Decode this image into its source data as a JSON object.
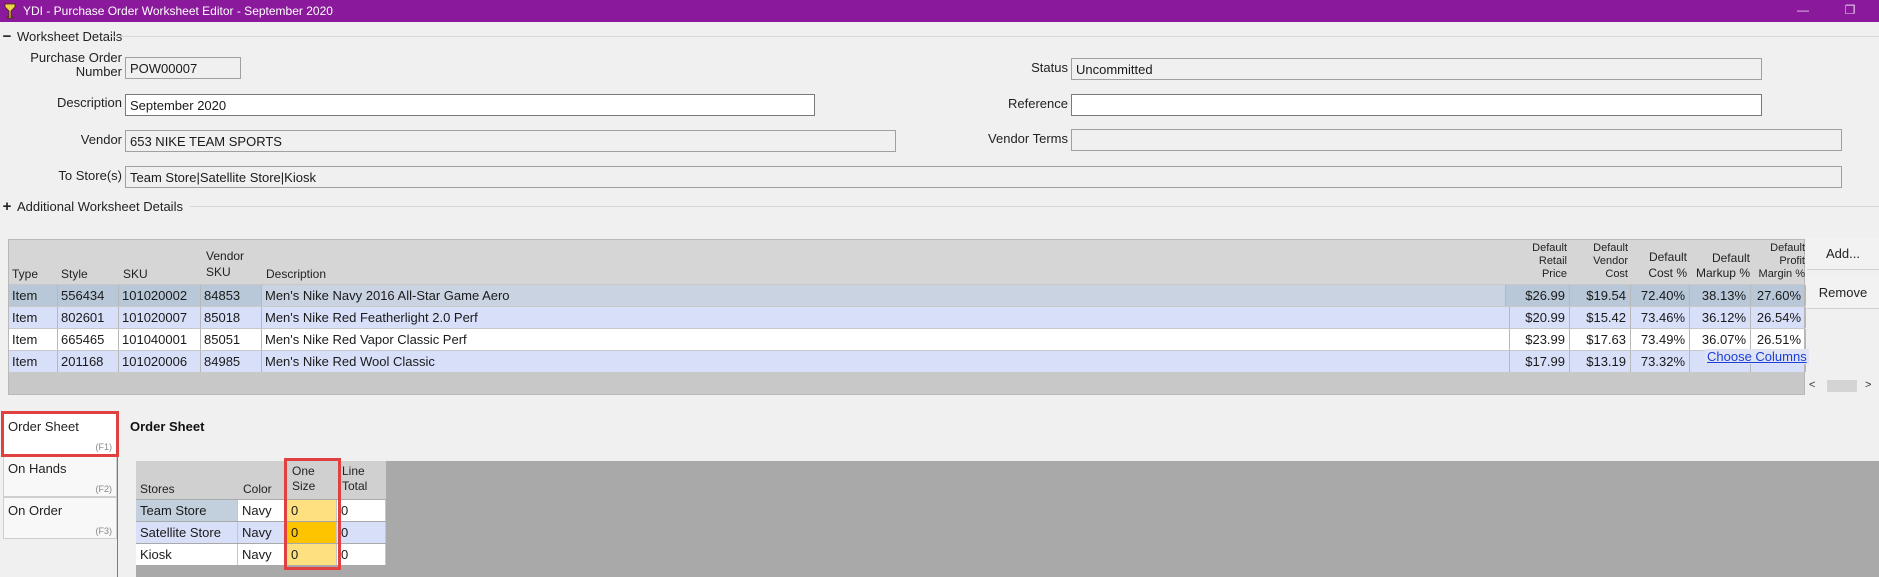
{
  "window": {
    "title": "YDI - Purchase Order Worksheet Editor - September 2020",
    "app_icon": "ydi-logo-icon",
    "title_color": "#8a1a9b"
  },
  "sections": {
    "worksheet_details": "Worksheet Details",
    "additional_details": "Additional Worksheet Details"
  },
  "form": {
    "po_number_label": "Purchase Order Number",
    "po_number": "POW00007",
    "description_label": "Description",
    "description": "September 2020",
    "vendor_label": "Vendor",
    "vendor": "653 NIKE TEAM SPORTS",
    "to_stores_label": "To Store(s)",
    "to_stores": "Team Store|Satellite Store|Kiosk",
    "status_label": "Status",
    "status": "Uncommitted",
    "reference_label": "Reference",
    "reference": "",
    "vendor_terms_label": "Vendor Terms",
    "vendor_terms": ""
  },
  "items_grid": {
    "headers": {
      "type": "Type",
      "style": "Style",
      "sku": "SKU",
      "vendor_sku_1": "Vendor",
      "vendor_sku_2": "SKU",
      "description": "Description",
      "retail_1": "Default",
      "retail_2": "Retail",
      "retail_3": "Price",
      "vcost_1": "Default",
      "vcost_2": "Vendor",
      "vcost_3": "Cost",
      "costpct_1": "Default",
      "costpct_2": "Cost %",
      "markup_1": "Default",
      "markup_2": "Markup %",
      "margin_1": "Default",
      "margin_2": "Profit",
      "margin_3": "Margin %"
    },
    "rows": [
      {
        "type": "Item",
        "style": "556434",
        "sku": "101020002",
        "vendor_sku": "84853",
        "description": "Men's Nike Navy 2016 All-Star Game Aero",
        "retail": "$26.99",
        "vendor_cost": "$19.54",
        "cost_pct": "72.40%",
        "markup_pct": "38.13%",
        "margin_pct": "27.60%"
      },
      {
        "type": "Item",
        "style": "802601",
        "sku": "101020007",
        "vendor_sku": "85018",
        "description": "Men's Nike Red Featherlight 2.0 Perf",
        "retail": "$20.99",
        "vendor_cost": "$15.42",
        "cost_pct": "73.46%",
        "markup_pct": "36.12%",
        "margin_pct": "26.54%"
      },
      {
        "type": "Item",
        "style": "665465",
        "sku": "101040001",
        "vendor_sku": "85051",
        "description": "Men's Nike Red Vapor Classic Perf",
        "retail": "$23.99",
        "vendor_cost": "$17.63",
        "cost_pct": "73.49%",
        "markup_pct": "36.07%",
        "margin_pct": "26.51%"
      },
      {
        "type": "Item",
        "style": "201168",
        "sku": "101020006",
        "vendor_sku": "84985",
        "description": "Men's Nike Red Wool Classic",
        "retail": "$17.99",
        "vendor_cost": "$13.19",
        "cost_pct": "73.32%",
        "markup_pct": "",
        "margin_pct": ""
      }
    ],
    "add_button": "Add...",
    "remove_button": "Remove",
    "choose_columns": "Choose Columns",
    "scroll_left": "<",
    "scroll_right": ">"
  },
  "tabs": [
    {
      "label": "Order Sheet",
      "key": "(F1)"
    },
    {
      "label": "On Hands",
      "key": "(F2)"
    },
    {
      "label": "On Order",
      "key": "(F3)"
    }
  ],
  "order_sheet": {
    "title": "Order Sheet",
    "headers": {
      "stores": "Stores",
      "color": "Color",
      "one_1": "One",
      "one_2": "Size",
      "line_1": "Line",
      "line_2": "Total"
    },
    "rows": [
      {
        "store": "Team Store",
        "color": "Navy",
        "one_size": "0",
        "line_total": "0"
      },
      {
        "store": "Satellite Store",
        "color": "Navy",
        "one_size": "0",
        "line_total": "0"
      },
      {
        "store": "Kiosk",
        "color": "Navy",
        "one_size": "0",
        "line_total": "0"
      }
    ]
  },
  "colors": {
    "highlight": "#e04040",
    "size_cell": "#ffe080",
    "size_cell_active": "#ffc400",
    "link": "#1a3fd8"
  }
}
